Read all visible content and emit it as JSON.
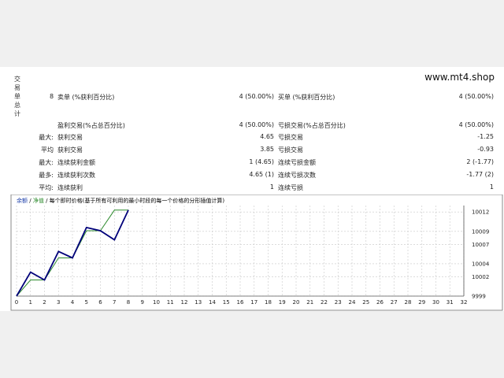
{
  "site": "www.mt4.shop",
  "side_label": [
    "交",
    "易",
    "单",
    "总",
    "计"
  ],
  "row1": {
    "count": "8",
    "sell_label": "卖单 (%获利百分比)",
    "sell_value": "4 (50.00%)",
    "buy_label": "买单 (%获利百分比)",
    "buy_value": "4 (50.00%)"
  },
  "row2": {
    "left_label": "盈利交易(%占总百分比)",
    "left_value": "4 (50.00%)",
    "right_label": "亏损交易(%占总百分比)",
    "right_value": "4 (50.00%)"
  },
  "row3": {
    "prefix": "最大:",
    "left_label": "获利交易",
    "left_value": "4.65",
    "right_label": "亏损交易",
    "right_value": "-1.25"
  },
  "row4": {
    "prefix": "平均",
    "left_label": "获利交易",
    "left_value": "3.85",
    "right_label": "亏损交易",
    "right_value": "-0.93"
  },
  "row5": {
    "prefix": "最大:",
    "left_label": "连续获利金额",
    "left_value": "1 (4.65)",
    "right_label": "连续亏损金额",
    "right_value": "2 (-1.77)"
  },
  "row6": {
    "prefix": "最多:",
    "left_label": "连续获利次数",
    "left_value": "4.65 (1)",
    "right_label": "连续亏损次数",
    "right_value": "-1.77 (2)"
  },
  "row7": {
    "prefix": "平均:",
    "left_label": "连续获利",
    "left_value": "1",
    "right_label": "连续亏损",
    "right_value": "1"
  },
  "chart_header": {
    "balance": "余额",
    "sep1": "/",
    "equity": "净值",
    "rest": "/ 每个即时价格(基于所有可利用的最小时段的每一个价格的分形插值计算)"
  },
  "colors": {
    "balance": "#00007a",
    "equity": "#2e8b2e",
    "grid": "#c8c8c8",
    "header_blue": "#1a3ca8",
    "header_green": "#2e8b2e"
  },
  "chart_data": {
    "type": "line",
    "x_ticks": [
      0,
      1,
      2,
      3,
      4,
      5,
      6,
      7,
      8,
      9,
      10,
      11,
      12,
      13,
      14,
      15,
      16,
      17,
      18,
      19,
      20,
      21,
      22,
      23,
      24,
      25,
      26,
      27,
      28,
      29,
      30,
      31,
      32
    ],
    "y_ticks": [
      9999,
      10002,
      10004,
      10007,
      10009,
      10012
    ],
    "xlim": [
      0,
      32
    ],
    "ylim": [
      9999,
      10013
    ],
    "grid": true,
    "series": [
      {
        "key": "balance",
        "x": [
          0,
          1,
          2,
          3,
          4,
          5,
          6,
          7,
          8
        ],
        "y": [
          9999,
          10002.7,
          10001.5,
          10005.9,
          10004.9,
          10009.6,
          10009.1,
          10007.7,
          10012.3
        ]
      },
      {
        "key": "equity",
        "x": [
          0,
          1,
          2,
          3,
          4,
          5,
          6,
          7,
          7.6,
          8
        ],
        "y": [
          9999,
          10001.5,
          10001.5,
          10004.9,
          10004.9,
          10009.1,
          10009.1,
          10012.3,
          10012.3,
          10012.3
        ]
      }
    ]
  }
}
